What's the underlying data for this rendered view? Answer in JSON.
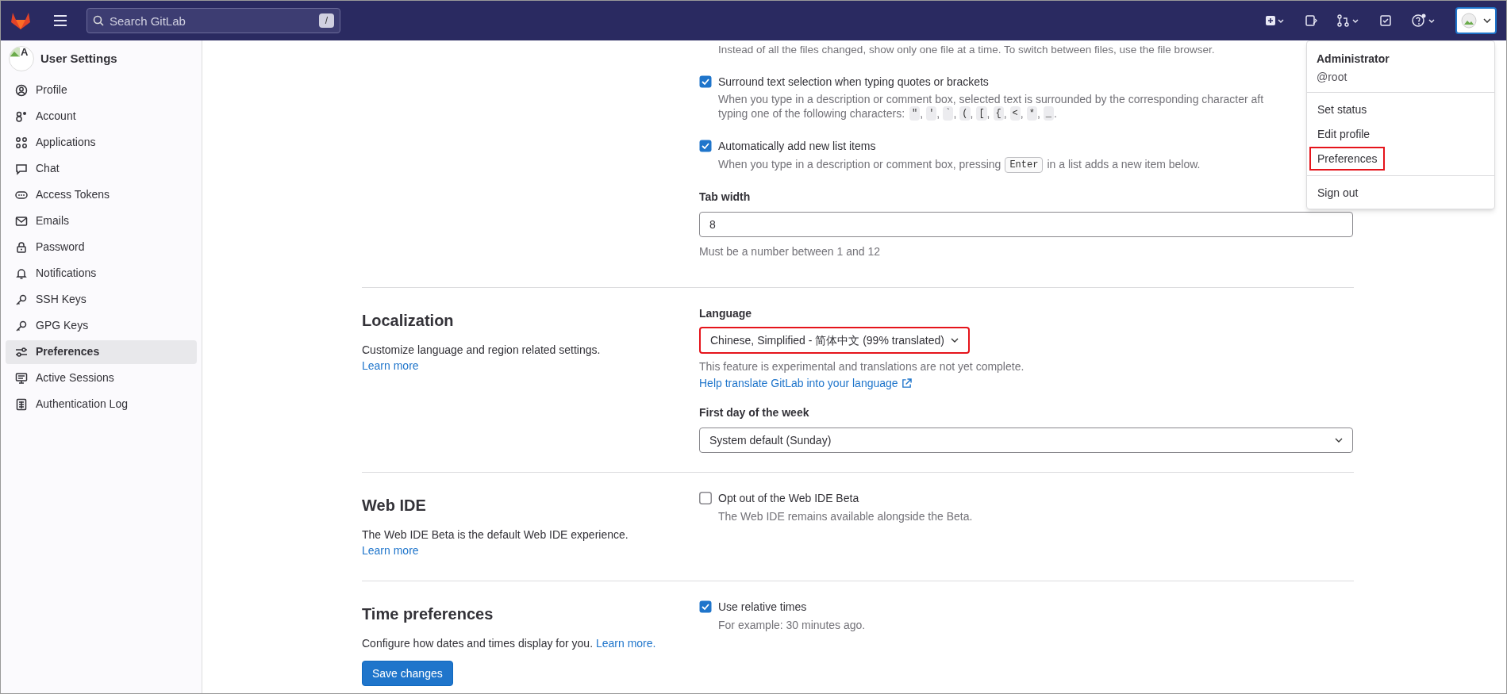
{
  "top_bar": {
    "search_placeholder": "Search GitLab",
    "search_shortcut": "/"
  },
  "sidebar": {
    "title": "User Settings",
    "avatar_alt": "A",
    "items": [
      {
        "label": "Profile",
        "selected": false
      },
      {
        "label": "Account",
        "selected": false
      },
      {
        "label": "Applications",
        "selected": false
      },
      {
        "label": "Chat",
        "selected": false
      },
      {
        "label": "Access Tokens",
        "selected": false
      },
      {
        "label": "Emails",
        "selected": false
      },
      {
        "label": "Password",
        "selected": false
      },
      {
        "label": "Notifications",
        "selected": false
      },
      {
        "label": "SSH Keys",
        "selected": false
      },
      {
        "label": "GPG Keys",
        "selected": false
      },
      {
        "label": "Preferences",
        "selected": true
      },
      {
        "label": "Active Sessions",
        "selected": false
      },
      {
        "label": "Authentication Log",
        "selected": false
      }
    ]
  },
  "behavior": {
    "cut_help": "Instead of all the files changed, show only one file at a time. To switch between files, use the file browser.",
    "options": [
      {
        "label": "Surround text selection when typing quotes or brackets",
        "checked": true,
        "help": "When you type in a description or comment box, selected text is surrounded by the corresponding character aft",
        "help2": "typing one of the following characters:",
        "chars": [
          {
            "char": "\"",
            "after": ","
          },
          {
            "char": "'",
            "after": ","
          },
          {
            "char": "`",
            "after": ","
          },
          {
            "char": "(",
            "after": ","
          },
          {
            "char": "[",
            "after": ","
          },
          {
            "char": "{",
            "after": ","
          },
          {
            "char": "<",
            "after": ","
          },
          {
            "char": "*",
            "after": ","
          },
          {
            "char": "_",
            "after": "."
          }
        ]
      },
      {
        "label": "Automatically add new list items",
        "checked": true,
        "help_before": "When you type in a description or comment box, pressing",
        "key": "Enter",
        "help_after": "in a list adds a new item below."
      }
    ],
    "tab_width": {
      "label": "Tab width",
      "value": "8",
      "help": "Must be a number between 1 and 12"
    }
  },
  "localization": {
    "title": "Localization",
    "description": "Customize language and region related settings.",
    "link": "Learn more",
    "language": {
      "label": "Language",
      "value": "Chinese, Simplified - 简体中文 (99% translated)",
      "highlighted": true,
      "help": "This feature is experimental and translations are not yet complete.",
      "link": "Help translate GitLab into your language"
    },
    "first_day": {
      "label": "First day of the week",
      "value": "System default (Sunday)"
    }
  },
  "web_ide": {
    "title": "Web IDE",
    "description": "The Web IDE Beta is the default Web IDE experience.",
    "link": "Learn more",
    "option": {
      "label": "Opt out of the Web IDE Beta",
      "checked": false,
      "help": "The Web IDE remains available alongside the Beta."
    }
  },
  "time_preferences": {
    "title": "Time preferences",
    "description": "Configure how dates and times display for you.",
    "link": "Learn more.",
    "option": {
      "label": "Use relative times",
      "checked": true,
      "help": "For example: 30 minutes ago."
    }
  },
  "save_button": "Save changes",
  "user_menu": {
    "name": "Administrator",
    "username": "@root",
    "items": [
      {
        "label": "Set status",
        "highlighted": false
      },
      {
        "label": "Edit profile",
        "highlighted": false
      },
      {
        "label": "Preferences",
        "highlighted": true
      },
      {
        "label": "Sign out",
        "highlighted": false
      }
    ]
  }
}
